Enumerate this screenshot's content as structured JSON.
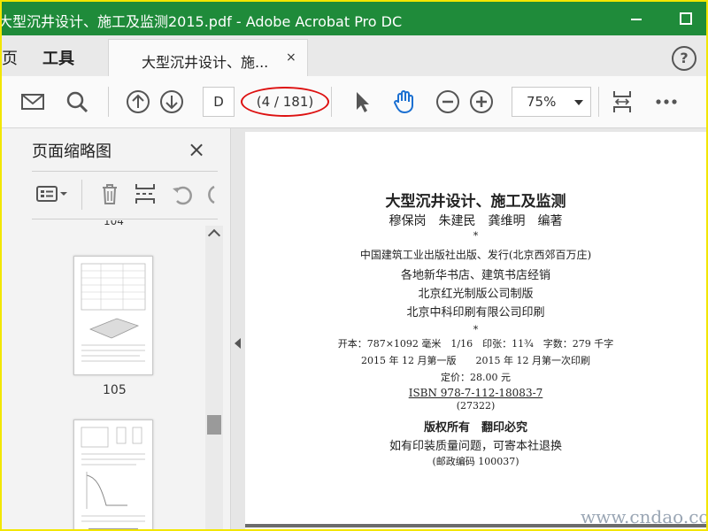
{
  "titlebar": {
    "title": "大型沉井设计、施工及监测2015.pdf - Adobe Acrobat Pro DC"
  },
  "tabs": {
    "home_label": "页",
    "tools_label": "工具",
    "doc_label": "大型沉井设计、施...",
    "doc_close": "×",
    "help_label": "?"
  },
  "toolbar": {
    "page_input": "D",
    "page_count": "(4 / 181)",
    "zoom": "75%"
  },
  "sidebar": {
    "title": "页面缩略图",
    "close": "×",
    "thumb_top_label": "104",
    "thumb_label": "105"
  },
  "document": {
    "title": "大型沉井设计、施工及监测",
    "authors": "穆保岗　朱建民　龚维明　编著",
    "star1": "*",
    "publisher": "中国建筑工业出版社出版、发行(北京西郊百万庄)",
    "distributor": "各地新华书店、建筑书店经销",
    "platemaker": "北京红光制版公司制版",
    "printer": "北京中科印刷有限公司印刷",
    "star2": "*",
    "format": "开本：787×1092 毫米　1/16　印张：11¾　字数：279 千字",
    "edition": "2015 年 12 月第一版　　2015 年 12 月第一次印刷",
    "price": "定价：28.00 元",
    "isbn": "ISBN 978-7-112-18083-7",
    "isbn_code": "(27322)",
    "rights": "版权所有　翻印必究",
    "notice": "如有印装质量问题，可寄本社退换",
    "postcode": "(邮政编码 100037)"
  },
  "watermark": "www.cndao.com"
}
